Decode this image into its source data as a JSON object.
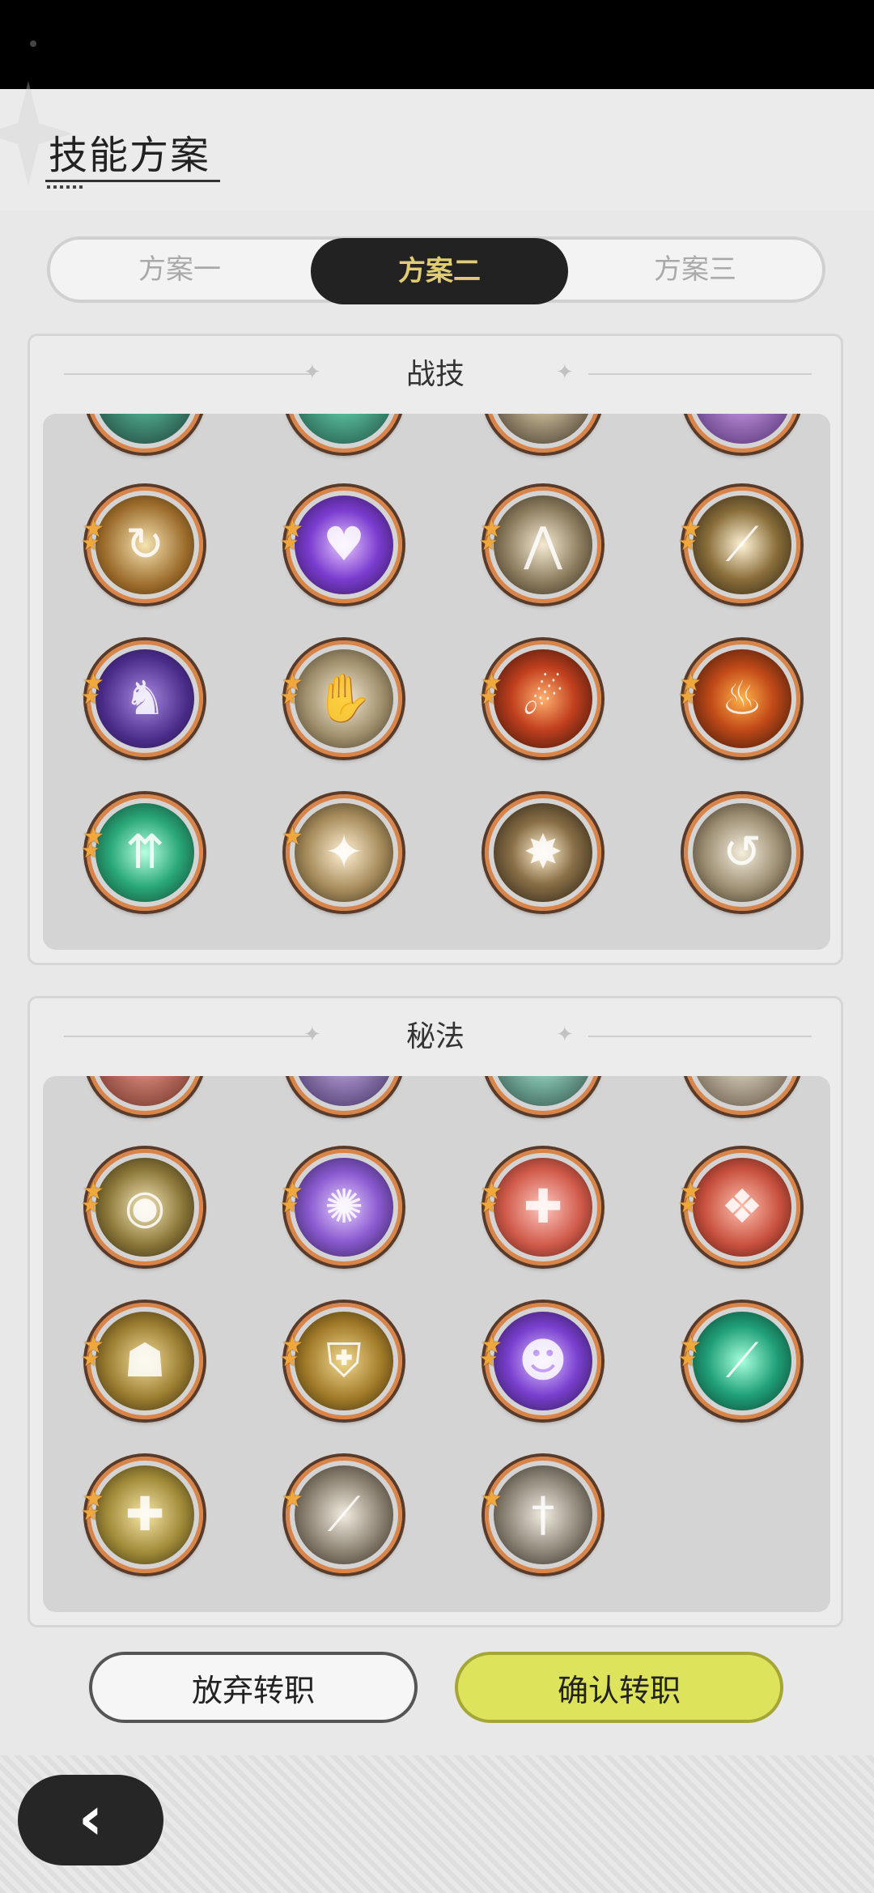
{
  "header": {
    "title": "技能方案"
  },
  "tabs": [
    {
      "label": "方案一",
      "active": false
    },
    {
      "label": "方案二",
      "active": true
    },
    {
      "label": "方案三",
      "active": false
    }
  ],
  "combat_section": {
    "title": "战技"
  },
  "secret_section": {
    "title": "秘法"
  },
  "buttons": {
    "cancel": "放弃转职",
    "confirm": "确认转职"
  },
  "colors": {
    "accent_tab_text": "#e0cc72",
    "confirm_bg": "#dde35a",
    "ring": "#d9854a"
  }
}
